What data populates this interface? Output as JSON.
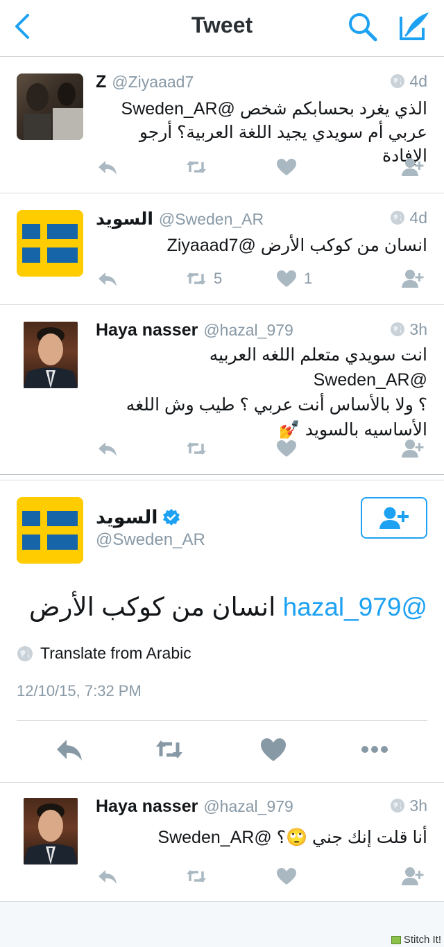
{
  "header": {
    "title": "Tweet"
  },
  "tweets": [
    {
      "name": "Z",
      "handle": "@Ziyaaad7",
      "time": "4d",
      "text_lines": [
        "الذي يغرد بحسابكم شخص @Sweden_AR",
        "عربي أم سويدي يجيد اللغة العربية؟ أرجو الإفادة"
      ],
      "retweets": "",
      "likes": ""
    },
    {
      "name": "السويد",
      "handle": "@Sweden_AR",
      "time": "4d",
      "text_lines": [
        "انسان من كوكب الأرض @Ziyaaad7"
      ],
      "retweets": "5",
      "likes": "1"
    },
    {
      "name": "Haya nasser",
      "handle": "@hazal_979",
      "time": "3h",
      "text_lines": [
        "انت سويدي متعلم اللغه العربيه @Sweden_AR",
        "؟ ولا بالأساس أنت عربي ؟ طيب وش اللغه",
        "الأساسيه بالسويد 💅"
      ],
      "retweets": "",
      "likes": ""
    }
  ],
  "main_tweet": {
    "name": "السويد",
    "handle": "@Sweden_AR",
    "mention": "@hazal_979",
    "text": "انسان من كوكب الأرض",
    "translate_label": "Translate from Arabic",
    "timestamp": "12/10/15, 7:32 PM"
  },
  "reply": {
    "name": "Haya nasser",
    "handle": "@hazal_979",
    "time": "3h",
    "text": "أنا قلت إنك جني 🙄؟ @Sweden_AR"
  },
  "watermark": "Stitch It!",
  "colors": {
    "accent": "#1da1f2",
    "icon_gray": "#aab8c2",
    "flag_yellow": "#ffcc00",
    "flag_blue": "#1565a8"
  }
}
